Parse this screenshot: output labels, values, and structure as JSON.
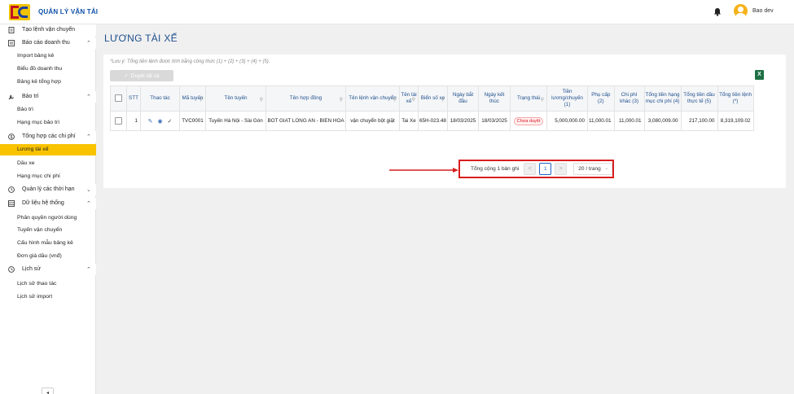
{
  "header": {
    "app_title": "QUẢN LÝ VẬN TẢI",
    "user_name": "Bao dev",
    "icons": {
      "logo": "company-logo",
      "bell": "bell-icon",
      "avatar": "user-avatar"
    }
  },
  "sidebar": {
    "items": [
      {
        "type": "group",
        "label": "Tạo lệnh vận chuyển",
        "icon": "document-icon",
        "chevron": ""
      },
      {
        "type": "group",
        "label": "Báo cáo doanh thu",
        "icon": "report-icon",
        "chevron": "^"
      },
      {
        "type": "sub",
        "label": "Import bảng kê"
      },
      {
        "type": "sub",
        "label": "Biểu đồ doanh thu"
      },
      {
        "type": "sub",
        "label": "Bảng kê tổng hợp"
      },
      {
        "type": "group",
        "label": "Bảo trì",
        "icon": "wrench-icon",
        "chevron": "^"
      },
      {
        "type": "sub",
        "label": "Bảo trì"
      },
      {
        "type": "sub",
        "label": "Hạng mục bảo trì"
      },
      {
        "type": "group",
        "label": "Tổng hợp các chi phí",
        "icon": "dollar-icon",
        "chevron": "^"
      },
      {
        "type": "sub",
        "label": "Lương tài xế",
        "active": true
      },
      {
        "type": "sub",
        "label": "Dầu xe"
      },
      {
        "type": "sub",
        "label": "Hạng mục chi phí"
      },
      {
        "type": "group",
        "label": "Quản lý các thời hạn",
        "icon": "clock-icon",
        "chevron": "v"
      },
      {
        "type": "group",
        "label": "Dữ liệu hệ thống",
        "icon": "database-icon",
        "chevron": "^"
      },
      {
        "type": "sub",
        "label": "Phân quyền người dùng"
      },
      {
        "type": "sub",
        "label": "Tuyến vận chuyển"
      },
      {
        "type": "sub",
        "label": "Cấu hình mẫu bảng kê"
      },
      {
        "type": "sub",
        "label": "Đơn giá dầu (vnđ)"
      },
      {
        "type": "group",
        "label": "Lịch sử",
        "icon": "history-icon",
        "chevron": "^"
      },
      {
        "type": "sub",
        "label": "Lịch sử thao tác"
      },
      {
        "type": "sub",
        "label": "Lịch sử import"
      }
    ],
    "collapse_glyph": "◂"
  },
  "main": {
    "page_title": "LƯƠNG TÀI XẾ",
    "note": "*Lưu ý: Tổng tiền lệnh được tính bằng công thức (1) + (2) + (3) + (4) + (5).",
    "approve_all_label": "Duyệt tất cả",
    "excel_icon": "excel-export-icon",
    "table": {
      "columns": [
        {
          "label": "",
          "search": false
        },
        {
          "label": "STT",
          "search": false
        },
        {
          "label": "Thao tác",
          "search": false
        },
        {
          "label": "Mã tuyến",
          "search": true
        },
        {
          "label": "Tên tuyến",
          "search": true
        },
        {
          "label": "Tên hợp đồng",
          "search": true
        },
        {
          "label": "Tên lệnh vận chuyển",
          "search": true
        },
        {
          "label": "Tên tài xế",
          "search": true
        },
        {
          "label": "Biển số xe",
          "search": true
        },
        {
          "label": "Ngày bắt đầu",
          "search": false
        },
        {
          "label": "Ngày kết thúc",
          "search": false
        },
        {
          "label": "Trạng thái",
          "search": true
        },
        {
          "label": "Tiền lương/chuyến (1)",
          "search": false
        },
        {
          "label": "Phụ cấp (2)",
          "search": false
        },
        {
          "label": "Chi phí khác (3)",
          "search": false
        },
        {
          "label": "Tổng tiền hạng mục chi phí (4)",
          "search": false
        },
        {
          "label": "Tổng tiền dầu thực tế (5)",
          "search": false
        },
        {
          "label": "Tổng tiền lệnh (*)",
          "search": false
        }
      ],
      "rows": [
        {
          "stt": "1",
          "ma_tuyen": "TVC0001",
          "ten_tuyen": "Tuyến Hà Nội - Sài Gòn",
          "ten_hop_dong": "BOT GIAT LONG AN - BIEN HOA",
          "ten_lenh": "vận chuyển bột giặt",
          "tai_xe": "Tai Xe",
          "bien_so": "65H-023.48",
          "ngay_bat_dau": "18/03/2025",
          "ngay_ket_thuc": "18/03/2025",
          "trang_thai": "Chưa duyệt",
          "tien_luong": "5,000,000.00",
          "phu_cap": "11,000.01",
          "chi_phi_khac": "11,000.01",
          "tong_hang_muc": "3,080,009.00",
          "tong_dau": "217,100.00",
          "tong_lenh": "8,319,109.02"
        }
      ]
    },
    "pagination": {
      "total_label": "Tổng cộng 1 bản ghi",
      "prev": "<",
      "current_page": "1",
      "next": ">",
      "page_size": "20 / trang"
    }
  }
}
